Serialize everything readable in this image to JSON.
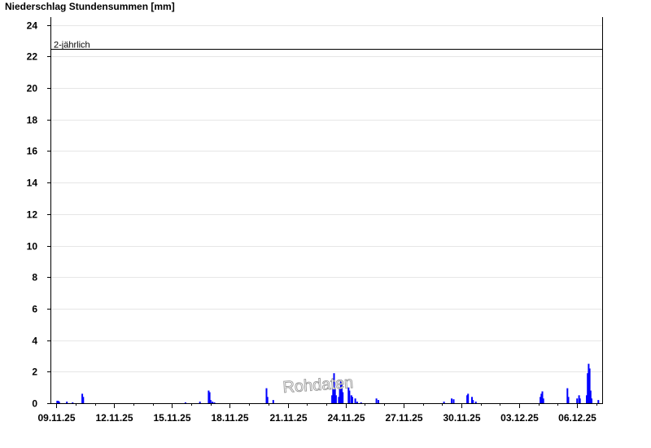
{
  "chart_data": {
    "type": "bar",
    "title": "Niederschlag Stundensummen [mm]",
    "xlabel": "",
    "ylabel": "",
    "ylim": [
      0,
      24.5
    ],
    "yticks": [
      0,
      2,
      4,
      6,
      8,
      10,
      12,
      14,
      16,
      18,
      20,
      22,
      24
    ],
    "xlim_days": [
      -0.3,
      28.3
    ],
    "xticks": [
      {
        "label": "09.11.25",
        "day": 0
      },
      {
        "label": "12.11.25",
        "day": 3
      },
      {
        "label": "15.11.25",
        "day": 6
      },
      {
        "label": "18.11.25",
        "day": 9
      },
      {
        "label": "21.11.25",
        "day": 12
      },
      {
        "label": "24.11.25",
        "day": 15
      },
      {
        "label": "27.11.25",
        "day": 18
      },
      {
        "label": "30.11.25",
        "day": 21
      },
      {
        "label": "03.12.25",
        "day": 24
      },
      {
        "label": "06.12.25",
        "day": 27
      }
    ],
    "threshold": {
      "label": "2-jährlich",
      "value": 22.5
    },
    "grid": true,
    "bar_color": "#0000ff",
    "watermark": "Rohdaten",
    "series": [
      {
        "values": [
          {
            "x": 0.05,
            "y": 0.15
          },
          {
            "x": 0.1,
            "y": 0.15
          },
          {
            "x": 0.15,
            "y": 0.1
          },
          {
            "x": 0.55,
            "y": 0.1
          },
          {
            "x": 0.85,
            "y": 0.05
          },
          {
            "x": 1.35,
            "y": 0.6
          },
          {
            "x": 1.4,
            "y": 0.4
          },
          {
            "x": 6.7,
            "y": 0.05
          },
          {
            "x": 7.45,
            "y": 0.1
          },
          {
            "x": 7.9,
            "y": 0.8
          },
          {
            "x": 7.95,
            "y": 0.7
          },
          {
            "x": 8.0,
            "y": 0.2
          },
          {
            "x": 8.1,
            "y": 0.1
          },
          {
            "x": 8.2,
            "y": 0.05
          },
          {
            "x": 10.9,
            "y": 0.95
          },
          {
            "x": 10.95,
            "y": 0.4
          },
          {
            "x": 11.25,
            "y": 0.2
          },
          {
            "x": 14.3,
            "y": 0.5
          },
          {
            "x": 14.35,
            "y": 1.1
          },
          {
            "x": 14.4,
            "y": 1.9
          },
          {
            "x": 14.45,
            "y": 0.9
          },
          {
            "x": 14.5,
            "y": 0.5
          },
          {
            "x": 14.65,
            "y": 0.4
          },
          {
            "x": 14.7,
            "y": 1.0
          },
          {
            "x": 14.75,
            "y": 1.5
          },
          {
            "x": 14.8,
            "y": 1.2
          },
          {
            "x": 14.85,
            "y": 0.7
          },
          {
            "x": 15.15,
            "y": 1.0
          },
          {
            "x": 15.2,
            "y": 0.8
          },
          {
            "x": 15.3,
            "y": 0.5
          },
          {
            "x": 15.35,
            "y": 0.4
          },
          {
            "x": 15.5,
            "y": 0.3
          },
          {
            "x": 15.6,
            "y": 0.1
          },
          {
            "x": 15.8,
            "y": 0.05
          },
          {
            "x": 16.6,
            "y": 0.3
          },
          {
            "x": 16.7,
            "y": 0.2
          },
          {
            "x": 20.1,
            "y": 0.1
          },
          {
            "x": 20.5,
            "y": 0.3
          },
          {
            "x": 20.6,
            "y": 0.25
          },
          {
            "x": 21.3,
            "y": 0.5
          },
          {
            "x": 21.35,
            "y": 0.6
          },
          {
            "x": 21.55,
            "y": 0.4
          },
          {
            "x": 21.6,
            "y": 0.2
          },
          {
            "x": 21.75,
            "y": 0.1
          },
          {
            "x": 25.1,
            "y": 0.4
          },
          {
            "x": 25.15,
            "y": 0.6
          },
          {
            "x": 25.2,
            "y": 0.75
          },
          {
            "x": 25.25,
            "y": 0.3
          },
          {
            "x": 26.5,
            "y": 0.95
          },
          {
            "x": 26.55,
            "y": 0.4
          },
          {
            "x": 27.0,
            "y": 0.3
          },
          {
            "x": 27.1,
            "y": 0.5
          },
          {
            "x": 27.15,
            "y": 0.3
          },
          {
            "x": 27.5,
            "y": 0.5
          },
          {
            "x": 27.55,
            "y": 1.9
          },
          {
            "x": 27.6,
            "y": 2.5
          },
          {
            "x": 27.65,
            "y": 2.2
          },
          {
            "x": 27.7,
            "y": 0.8
          },
          {
            "x": 27.75,
            "y": 0.3
          },
          {
            "x": 28.1,
            "y": 0.2
          }
        ]
      }
    ]
  }
}
